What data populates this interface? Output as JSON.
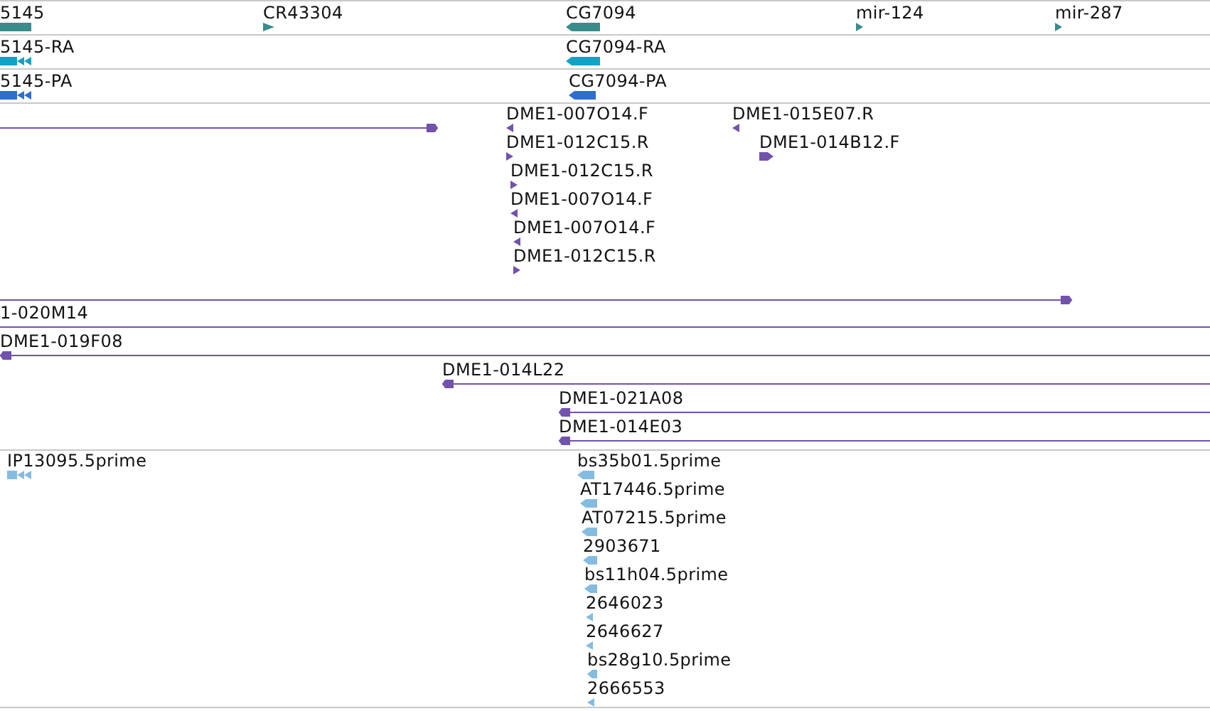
{
  "tracks": [
    {
      "color": "#3a8c8c",
      "features": [
        {
          "label": "5145",
          "kind": "plain"
        },
        {
          "label": "CR43304",
          "kind": "arrow",
          "reverse": false
        },
        {
          "label": "CG7094",
          "kind": "block",
          "reverse": true
        },
        {
          "label": "mir-124",
          "kind": "arrow",
          "reverse": false
        },
        {
          "label": "mir-287",
          "kind": "arrow",
          "reverse": false
        }
      ]
    },
    {
      "color": "#13a2c2",
      "features": [
        {
          "label": "5145-RA",
          "kind": "exons",
          "reverse": true
        },
        {
          "label": "CG7094-RA",
          "kind": "block",
          "reverse": true
        }
      ]
    },
    {
      "color": "#2c6ed3",
      "features": [
        {
          "label": "5145-PA",
          "kind": "exons",
          "reverse": true
        },
        {
          "label": "CG7094-PA",
          "kind": "block",
          "reverse": true
        }
      ]
    },
    {
      "color": "#7152ad",
      "features": [
        {
          "label": "DME1-007O14.F",
          "kind": "arrow",
          "reverse": true
        },
        {
          "label": "DME1-015E07.R",
          "kind": "arrow",
          "reverse": true
        },
        {
          "kind": "line",
          "reverse": false
        },
        {
          "label": "DME1-012C15.R",
          "kind": "arrow",
          "reverse": false
        },
        {
          "label": "DME1-014B12.F",
          "kind": "block",
          "reverse": false
        },
        {
          "label": "DME1-012C15.R",
          "kind": "arrow",
          "reverse": false
        },
        {
          "label": "DME1-007O14.F",
          "kind": "arrow",
          "reverse": true
        },
        {
          "label": "DME1-007O14.F",
          "kind": "arrow",
          "reverse": true
        },
        {
          "label": "DME1-012C15.R",
          "kind": "arrow",
          "reverse": false
        },
        {
          "kind": "line",
          "reverse": false
        },
        {
          "label": "1-020M14",
          "kind": "span"
        },
        {
          "label": "DME1-019F08",
          "kind": "line",
          "reverse": true
        },
        {
          "label": "DME1-014L22",
          "kind": "line",
          "reverse": true
        },
        {
          "label": "DME1-021A08",
          "kind": "line",
          "reverse": true
        },
        {
          "label": "DME1-014E03",
          "kind": "line",
          "reverse": true
        }
      ]
    },
    {
      "color": "#84bce0",
      "features": [
        {
          "label": "IP13095.5prime",
          "kind": "exons",
          "reverse": true
        },
        {
          "label": "bs35b01.5prime",
          "kind": "block",
          "reverse": true
        },
        {
          "label": "AT17446.5prime",
          "kind": "block",
          "reverse": true
        },
        {
          "label": "AT07215.5prime",
          "kind": "block",
          "reverse": true
        },
        {
          "label": "2903671",
          "kind": "block",
          "reverse": true
        },
        {
          "label": "bs11h04.5prime",
          "kind": "block",
          "reverse": true
        },
        {
          "label": "2646023",
          "kind": "arrow",
          "reverse": true
        },
        {
          "label": "2646627",
          "kind": "arrow",
          "reverse": true
        },
        {
          "label": "bs28g10.5prime",
          "kind": "block",
          "reverse": true
        },
        {
          "label": "2666553",
          "kind": "arrow",
          "reverse": true
        }
      ]
    }
  ]
}
